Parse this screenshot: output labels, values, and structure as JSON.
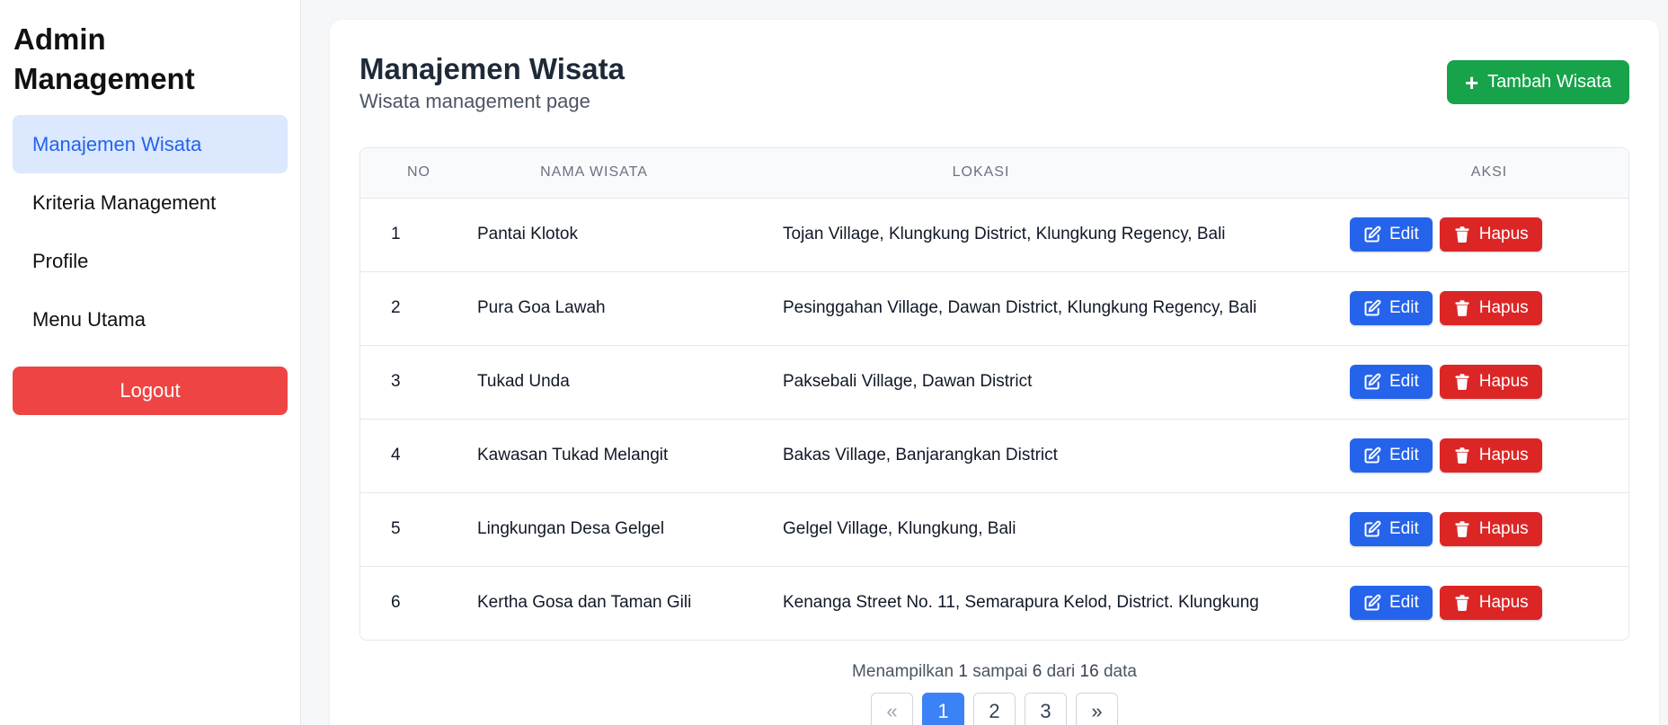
{
  "sidebar": {
    "brand": "Admin Management",
    "items": [
      {
        "label": "Manajemen Wisata",
        "active": true
      },
      {
        "label": "Kriteria Management",
        "active": false
      },
      {
        "label": "Profile",
        "active": false
      },
      {
        "label": "Menu Utama",
        "active": false
      }
    ],
    "logout_label": "Logout"
  },
  "header": {
    "title": "Manajemen Wisata",
    "subtitle": "Wisata management page",
    "add_label": "Tambah Wisata"
  },
  "table": {
    "columns": [
      "NO",
      "NAMA WISATA",
      "LOKASI",
      "AKSI"
    ],
    "edit_label": "Edit",
    "delete_label": "Hapus",
    "rows": [
      {
        "no": "1",
        "name": "Pantai Klotok",
        "location": "Tojan Village, Klungkung District, Klungkung Regency, Bali"
      },
      {
        "no": "2",
        "name": "Pura Goa Lawah",
        "location": "Pesinggahan Village, Dawan District, Klungkung Regency, Bali"
      },
      {
        "no": "3",
        "name": "Tukad Unda",
        "location": "Paksebali Village, Dawan District"
      },
      {
        "no": "4",
        "name": "Kawasan Tukad Melangit",
        "location": "Bakas Village, Banjarangkan District"
      },
      {
        "no": "5",
        "name": "Lingkungan Desa Gelgel",
        "location": "Gelgel Village, Klungkung, Bali"
      },
      {
        "no": "6",
        "name": "Kertha Gosa dan Taman Gili",
        "location": "Kenanga Street No. 11, Semarapura Kelod, District. Klungkung"
      }
    ]
  },
  "pagination": {
    "text_prefix": "Menampilkan",
    "from": "1",
    "text_mid1": "sampai",
    "to": "6",
    "text_mid2": "dari",
    "total": "16",
    "text_suffix": "data",
    "prev": "«",
    "pages": [
      "1",
      "2",
      "3"
    ],
    "current": "1",
    "next": "»"
  },
  "colors": {
    "accent": "#2563eb",
    "success": "#16a34a",
    "danger": "#dc2626",
    "logout": "#ef4444",
    "active_nav_bg": "#dbe8fe"
  }
}
